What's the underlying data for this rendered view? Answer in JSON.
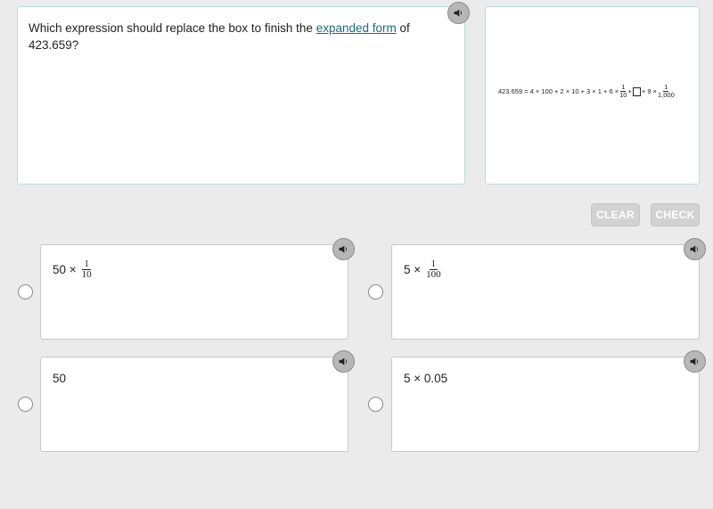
{
  "question": {
    "text_before": "Which expression should replace the box to finish the ",
    "link_text": "expanded form",
    "text_after": " of 423.659?",
    "audio_icon": "speaker-icon"
  },
  "equation_image": {
    "lhs": "423.659 = 4 × 100 + 2 × 10 + 3 × 1 + 6 × ",
    "frac1_num": "1",
    "frac1_den": "10",
    "plus1": " + ",
    "plus2": "+ 9 × ",
    "frac2_num": "1",
    "frac2_den": "1,000"
  },
  "buttons": {
    "clear": "CLEAR",
    "check": "CHECK"
  },
  "options": [
    {
      "prefix": "50 ×",
      "frac_num": "1",
      "frac_den": "10"
    },
    {
      "prefix": "5 ×",
      "frac_num": "1",
      "frac_den": "100"
    },
    {
      "prefix": "50"
    },
    {
      "prefix": "5 × 0.05"
    }
  ]
}
